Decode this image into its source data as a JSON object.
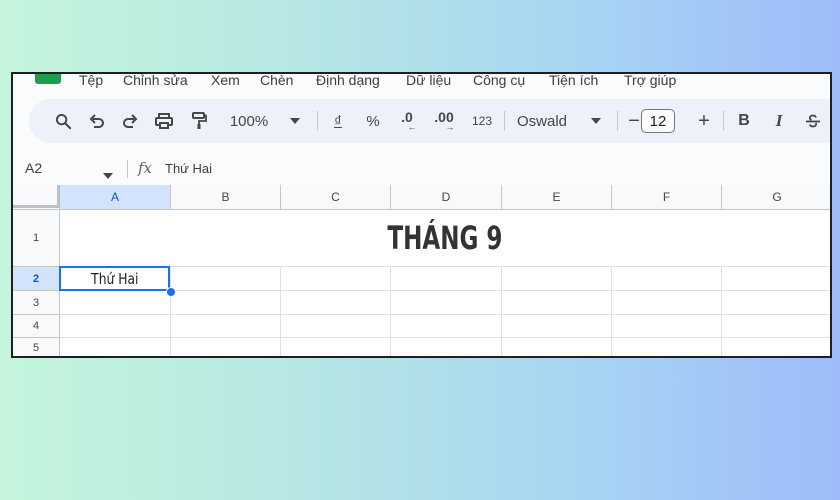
{
  "menu": [
    "Tệp",
    "Chỉnh sửa",
    "Xem",
    "Chèn",
    "Định dạng",
    "Dữ liệu",
    "Công cụ",
    "Tiện ích",
    "Trợ giúp"
  ],
  "toolbar": {
    "zoom": "100%",
    "currency": "₫",
    "percent": "%",
    "decrease_decimal": ".0",
    "increase_decimal": ".00",
    "number_format": "123",
    "font": "Oswald",
    "font_size": "12",
    "minus": "−",
    "plus": "+",
    "bold": "B",
    "italic": "I"
  },
  "formula_bar": {
    "cell_ref": "A2",
    "fx": "fx",
    "content": "Thứ Hai"
  },
  "columns": [
    "A",
    "B",
    "C",
    "D",
    "E",
    "F",
    "G"
  ],
  "rows": [
    "1",
    "2",
    "3",
    "4",
    "5"
  ],
  "cells": {
    "title": "THÁNG 9",
    "a2": "Thứ Hai"
  },
  "colors": {
    "accent": "#1a73e8",
    "toolbar_bg": "#edf2fa",
    "selected_header": "#d3e3fd"
  }
}
